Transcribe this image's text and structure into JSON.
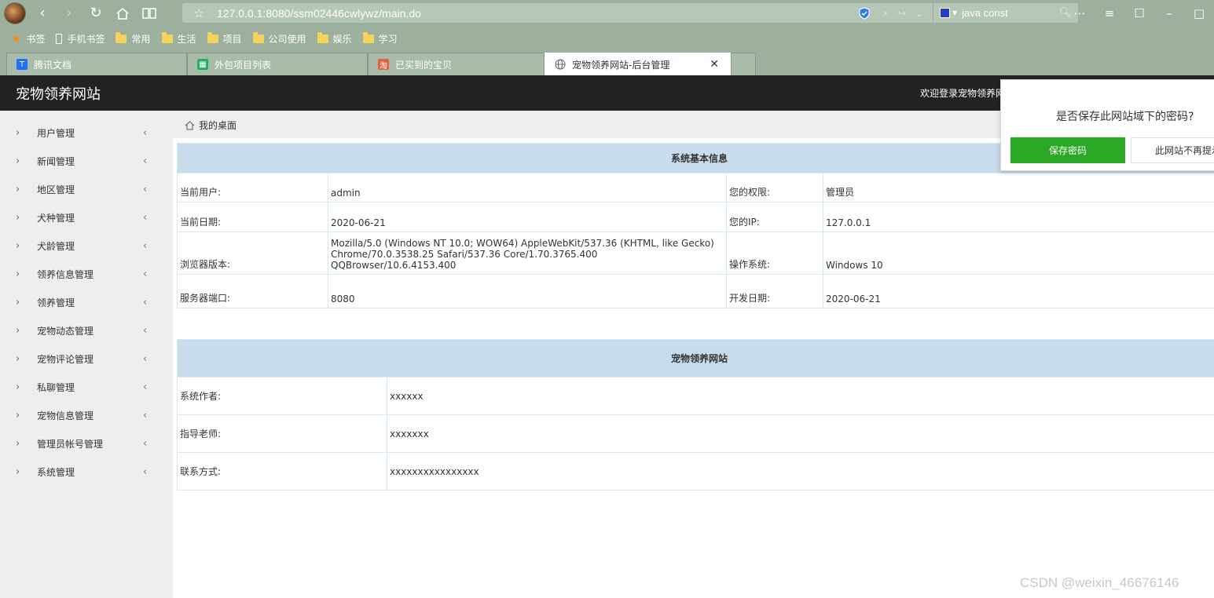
{
  "browser": {
    "url": "127.0.0.1:8080/ssm02446cwlywz/main.do",
    "search_query": "java const",
    "bookmarks": [
      "书签",
      "手机书签",
      "常用",
      "生活",
      "项目",
      "公司使用",
      "娱乐",
      "学习"
    ],
    "tabs": [
      {
        "label": "腾讯文档",
        "icon": "tencent-docs-icon",
        "color": "#1e6fff"
      },
      {
        "label": "外包项目列表",
        "icon": "grid-doc-icon",
        "color": "#1fb160"
      },
      {
        "label": "已买到的宝贝",
        "icon": "taobao-icon",
        "color": "#e2603b"
      },
      {
        "label": "宠物领养网站-后台管理",
        "icon": "globe-icon",
        "active": true
      }
    ]
  },
  "header": {
    "brand": "宠物领养网站",
    "welcome": "欢迎登录宠物领养网"
  },
  "sidebar": {
    "items": [
      {
        "label": "用户管理"
      },
      {
        "label": "新闻管理"
      },
      {
        "label": "地区管理"
      },
      {
        "label": "犬种管理"
      },
      {
        "label": "犬龄管理"
      },
      {
        "label": "领养信息管理"
      },
      {
        "label": "领养管理"
      },
      {
        "label": "宠物动态管理"
      },
      {
        "label": "宠物评论管理"
      },
      {
        "label": "私聊管理"
      },
      {
        "label": "宠物信息管理"
      },
      {
        "label": "管理员帐号管理"
      },
      {
        "label": "系统管理"
      }
    ]
  },
  "breadcrumb": {
    "label": "我的桌面"
  },
  "sys_info": {
    "title": "系统基本信息",
    "rows": [
      {
        "k1": "当前用户:",
        "v1": "admin",
        "k2": "您的权限:",
        "v2": "管理员"
      },
      {
        "k1": "当前日期:",
        "v1": "2020-06-21",
        "k2": "您的IP:",
        "v2": "127.0.0.1"
      },
      {
        "k1": "浏览器版本:",
        "v1a": "Mozilla/5.0 (Windows NT 10.0; WOW64) AppleWebKit/537.36 (KHTML, like Gecko)",
        "v1b": "Chrome/70.0.3538.25 Safari/537.36 Core/1.70.3765.400 QQBrowser/10.6.4153.400",
        "k2": "操作系统:",
        "v2": "Windows 10"
      },
      {
        "k1": "服务器端口:",
        "v1": "8080",
        "k2": "开发日期:",
        "v2": "2020-06-21"
      }
    ]
  },
  "site_info": {
    "title": "宠物领养网站",
    "rows": [
      {
        "k": "系统作者:",
        "v": "xxxxxx"
      },
      {
        "k": "指导老师:",
        "v": "xxxxxxx"
      },
      {
        "k": "联系方式:",
        "v": "xxxxxxxxxxxxxxxx"
      }
    ]
  },
  "password_prompt": {
    "question": "是否保存此网站域下的密码?",
    "save_label": "保存密码",
    "never_label": "此网站不再提示"
  },
  "watermark": "CSDN @weixin_46676146"
}
